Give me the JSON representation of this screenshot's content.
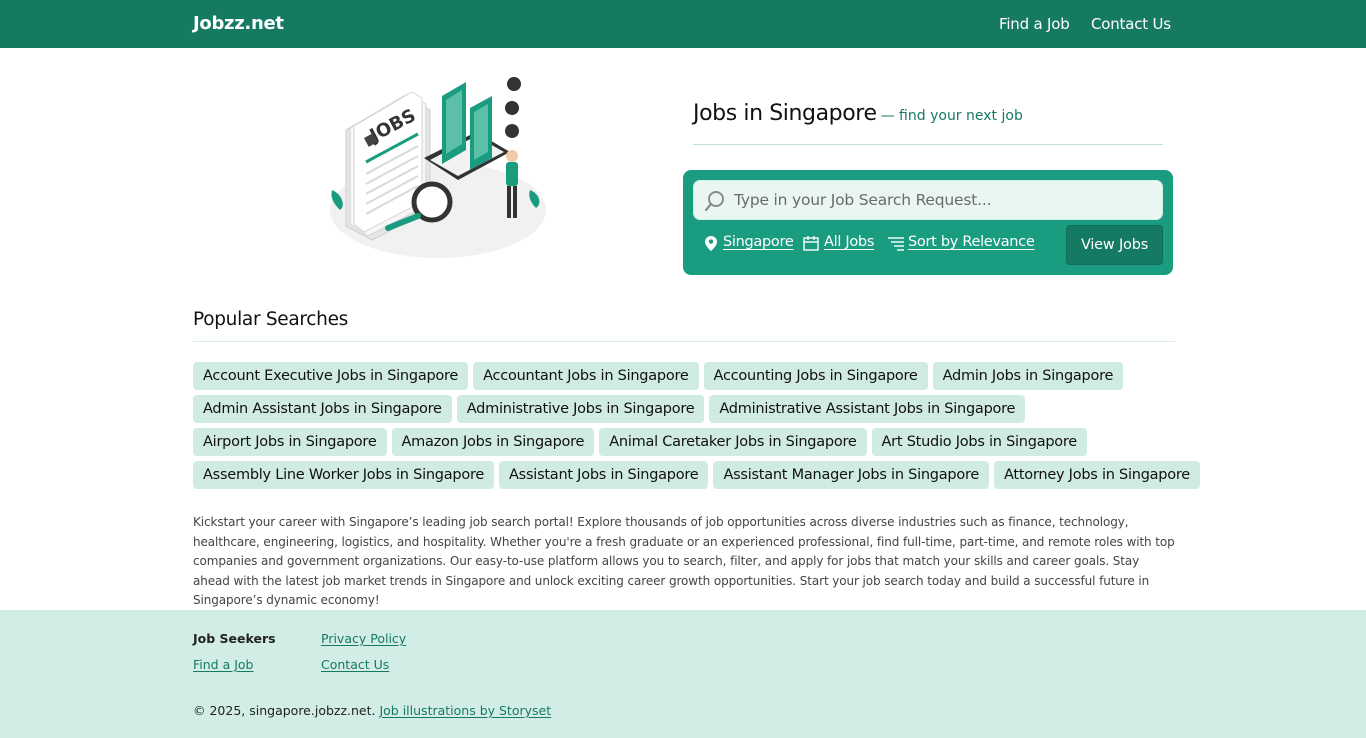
{
  "nav": {
    "brand": "Jobzz.net",
    "links": [
      "Find a Job",
      "Contact Us"
    ]
  },
  "hero": {
    "illustration_text": "JOBS",
    "title": "Jobs in Singapore",
    "subtitle": "— find your next job"
  },
  "search": {
    "placeholder": "Type in your Job Search Request...",
    "location": "Singapore",
    "category": "All Jobs",
    "sort": "Sort by Relevance",
    "button": "View Jobs",
    "icons": {
      "search": "search-icon",
      "location": "map-pin-icon",
      "category": "calendar-icon",
      "sort": "sort-lines-icon"
    }
  },
  "popular": {
    "title": "Popular Searches",
    "rows": [
      [
        "Account Executive Jobs in Singapore",
        "Accountant Jobs in Singapore",
        "Accounting Jobs in Singapore",
        "Admin Jobs in Singapore"
      ],
      [
        "Admin Assistant Jobs in Singapore",
        "Administrative Jobs in Singapore",
        "Administrative Assistant Jobs in Singapore"
      ],
      [
        "Airport Jobs in Singapore",
        "Amazon Jobs in Singapore",
        "Animal Caretaker Jobs in Singapore",
        "Art Studio Jobs in Singapore"
      ],
      [
        "Assembly Line Worker Jobs in Singapore",
        "Assistant Jobs in Singapore",
        "Assistant Manager Jobs in Singapore",
        "Attorney Jobs in Singapore"
      ]
    ]
  },
  "description": "Kickstart your career with Singapore’s leading job search portal! Explore thousands of job opportunities across diverse industries such as finance, technology, healthcare, engineering, logistics, and hospitality. Whether you're a fresh graduate or an experienced professional, find full-time, part-time, and remote roles with top companies and government organizations. Our easy-to-use platform allows you to search, filter, and apply for jobs that match your skills and career goals. Stay ahead with the latest job market trends in Singapore and unlock exciting career growth opportunities. Start your job search today and build a successful future in Singapore’s dynamic economy!",
  "footer": {
    "heading": "Job Seekers",
    "find_job": "Find a Job",
    "privacy": "Privacy Policy",
    "contact": "Contact Us",
    "copyright": "© 2025, singapore.jobzz.net.",
    "credit": "Job illustrations by Storyset"
  },
  "colors": {
    "brand": "#167a63",
    "search_panel": "#1a9c80",
    "tag_bg": "#d0ebe4",
    "footer_bg": "#d2ece6"
  }
}
